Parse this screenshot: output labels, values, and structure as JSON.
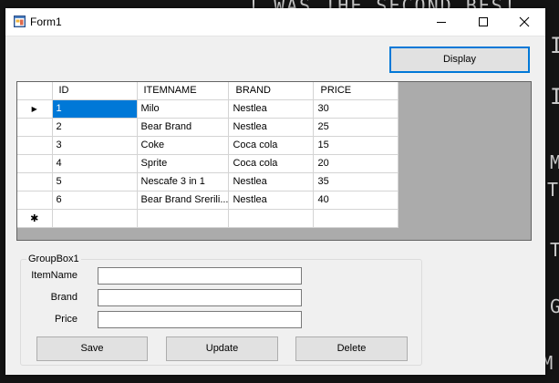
{
  "window": {
    "title": "Form1"
  },
  "titlebar": {
    "icons": [
      "app-icon",
      "minimize-icon",
      "maximize-icon",
      "close-icon"
    ]
  },
  "toolbar": {
    "display_label": "Display"
  },
  "grid": {
    "columns": [
      "ID",
      "ITEMNAME",
      "BRAND",
      "PRICE"
    ],
    "rows": [
      {
        "id": "1",
        "itemname": "Milo",
        "brand": "Nestlea",
        "price": "30"
      },
      {
        "id": "2",
        "itemname": "Bear Brand",
        "brand": "Nestlea",
        "price": "25"
      },
      {
        "id": "3",
        "itemname": "Coke",
        "brand": "Coca cola",
        "price": "15"
      },
      {
        "id": "4",
        "itemname": "Sprite",
        "brand": "Coca cola",
        "price": "20"
      },
      {
        "id": "5",
        "itemname": "Nescafe 3 in 1",
        "brand": "Nestlea",
        "price": "35"
      },
      {
        "id": "6",
        "itemname": "Bear Brand Srerili...",
        "brand": "Nestlea",
        "price": "40"
      }
    ],
    "current_row_marker": "▶",
    "new_row_marker": "✱"
  },
  "groupbox": {
    "title": "GroupBox1",
    "itemname_label": "ItemName",
    "brand_label": "Brand",
    "price_label": "Price",
    "itemname_value": "",
    "brand_value": "",
    "price_value": ""
  },
  "actions": {
    "save_label": "Save",
    "update_label": "Update",
    "delete_label": "Delete"
  },
  "colors": {
    "accent": "#0078d7",
    "grid_background": "#ababab",
    "window_background": "#f0f0f0"
  }
}
